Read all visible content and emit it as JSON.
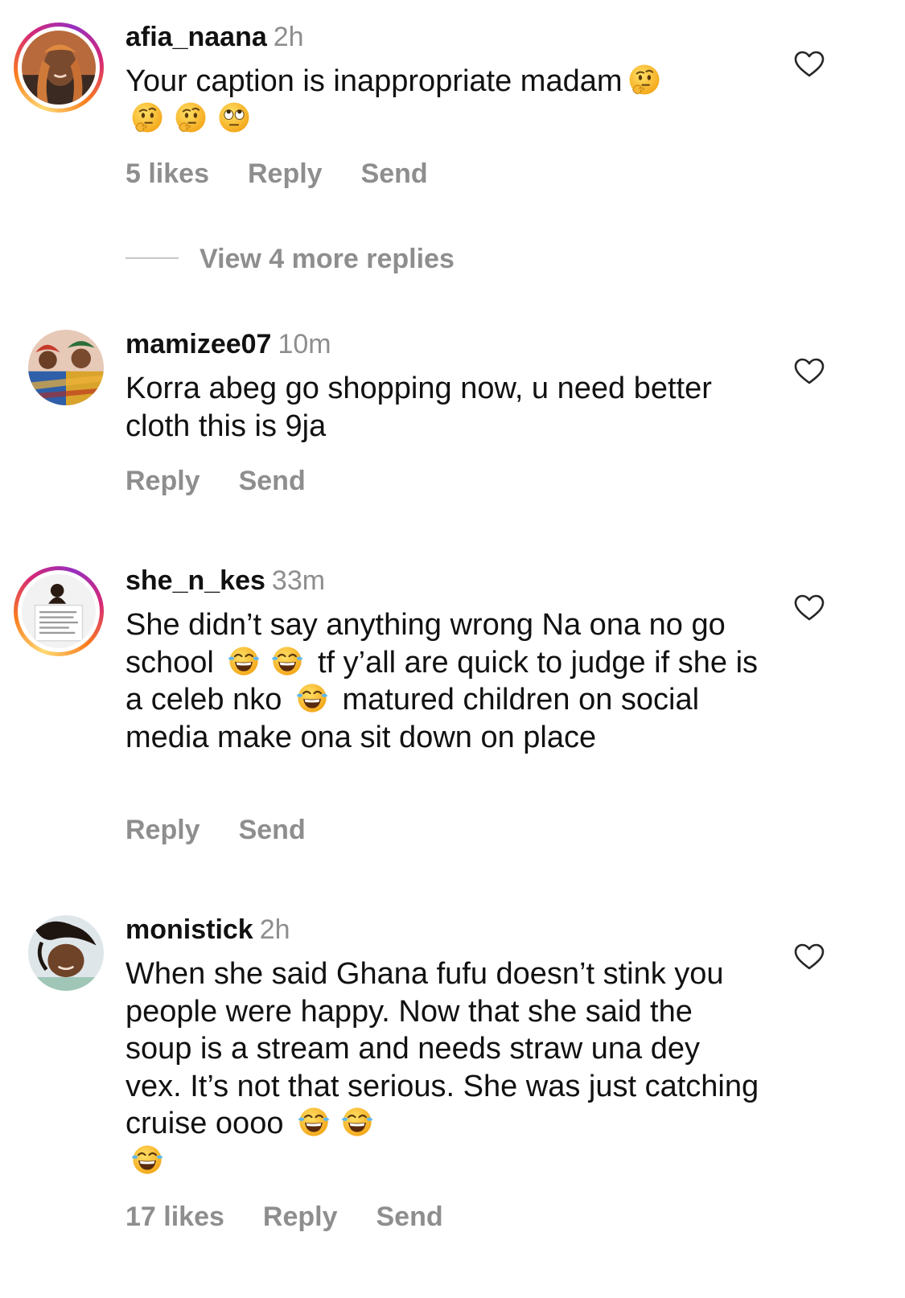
{
  "comments": [
    {
      "username": "afia_naana",
      "time": "2h",
      "text_parts": [
        "Your caption is inappropriate madam"
      ],
      "likes": "5 likes",
      "reply": "Reply",
      "send": "Send"
    },
    {
      "username": "mamizee07",
      "time": "10m",
      "text_parts": [
        "Korra abeg go shopping now, u need better cloth this is 9ja"
      ],
      "reply": "Reply",
      "send": "Send"
    },
    {
      "username": "she_n_kes",
      "time": "33m",
      "text_parts": [
        "She didn’t say anything wrong Na ona no go school ",
        " tf y’all are quick to judge if she is a celeb nko ",
        " matured children on social media make ona sit down on place"
      ],
      "reply": "Reply",
      "send": "Send"
    },
    {
      "username": "monistick",
      "time": "2h",
      "text_parts": [
        "When she said Ghana fufu doesn’t stink you people were happy. Now that she said the soup is a stream and needs straw una dey vex. It’s not that serious. She was just catching cruise oooo "
      ],
      "likes": "17 likes",
      "reply": "Reply",
      "send": "Send"
    }
  ],
  "view_more_replies": "View 4 more replies",
  "icons": {
    "heart": "heart-outline-icon",
    "thinking": "thinking-face-emoji",
    "eye_roll": "face-with-rolling-eyes-emoji",
    "laughing": "face-with-tears-of-joy-emoji"
  },
  "colors": {
    "text": "#111111",
    "muted": "#8e8e8e",
    "heart_stroke": "#8e8e8e",
    "emoji_yellow": "#fcc21b"
  }
}
